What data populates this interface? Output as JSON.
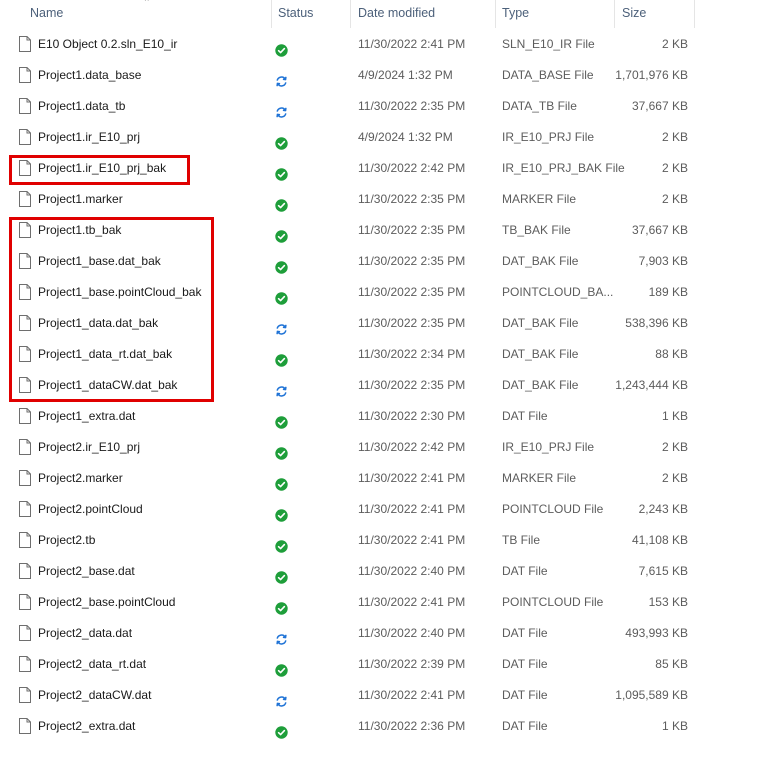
{
  "columns": {
    "name": "Name",
    "status": "Status",
    "date": "Date modified",
    "type": "Type",
    "size": "Size"
  },
  "sort": {
    "column": "name",
    "icon": "chevron-up-icon"
  },
  "colors": {
    "synced": "#1e9e3a",
    "syncing": "#1f73d6",
    "highlight": "#e00000"
  },
  "files": [
    {
      "name": "E10 Object 0.2.sln_E10_ir",
      "status": "synced",
      "date": "11/30/2022 2:41 PM",
      "type": "SLN_E10_IR File",
      "size": "2 KB"
    },
    {
      "name": "Project1.data_base",
      "status": "syncing",
      "date": "4/9/2024 1:32 PM",
      "type": "DATA_BASE File",
      "size": "1,701,976 KB"
    },
    {
      "name": "Project1.data_tb",
      "status": "syncing",
      "date": "11/30/2022 2:35 PM",
      "type": "DATA_TB File",
      "size": "37,667 KB"
    },
    {
      "name": "Project1.ir_E10_prj",
      "status": "synced",
      "date": "4/9/2024 1:32 PM",
      "type": "IR_E10_PRJ File",
      "size": "2 KB"
    },
    {
      "name": "Project1.ir_E10_prj_bak",
      "status": "synced",
      "date": "11/30/2022 2:42 PM",
      "type": "IR_E10_PRJ_BAK File",
      "size": "2 KB"
    },
    {
      "name": "Project1.marker",
      "status": "synced",
      "date": "11/30/2022 2:35 PM",
      "type": "MARKER File",
      "size": "2 KB"
    },
    {
      "name": "Project1.tb_bak",
      "status": "synced",
      "date": "11/30/2022 2:35 PM",
      "type": "TB_BAK File",
      "size": "37,667 KB"
    },
    {
      "name": "Project1_base.dat_bak",
      "status": "synced",
      "date": "11/30/2022 2:35 PM",
      "type": "DAT_BAK File",
      "size": "7,903 KB"
    },
    {
      "name": "Project1_base.pointCloud_bak",
      "status": "synced",
      "date": "11/30/2022 2:35 PM",
      "type": "POINTCLOUD_BA...",
      "size": "189 KB"
    },
    {
      "name": "Project1_data.dat_bak",
      "status": "syncing",
      "date": "11/30/2022 2:35 PM",
      "type": "DAT_BAK File",
      "size": "538,396 KB"
    },
    {
      "name": "Project1_data_rt.dat_bak",
      "status": "synced",
      "date": "11/30/2022 2:34 PM",
      "type": "DAT_BAK File",
      "size": "88 KB"
    },
    {
      "name": "Project1_dataCW.dat_bak",
      "status": "syncing",
      "date": "11/30/2022 2:35 PM",
      "type": "DAT_BAK File",
      "size": "1,243,444 KB"
    },
    {
      "name": "Project1_extra.dat",
      "status": "synced",
      "date": "11/30/2022 2:30 PM",
      "type": "DAT File",
      "size": "1 KB"
    },
    {
      "name": "Project2.ir_E10_prj",
      "status": "synced",
      "date": "11/30/2022 2:42 PM",
      "type": "IR_E10_PRJ File",
      "size": "2 KB"
    },
    {
      "name": "Project2.marker",
      "status": "synced",
      "date": "11/30/2022 2:41 PM",
      "type": "MARKER File",
      "size": "2 KB"
    },
    {
      "name": "Project2.pointCloud",
      "status": "synced",
      "date": "11/30/2022 2:41 PM",
      "type": "POINTCLOUD File",
      "size": "2,243 KB"
    },
    {
      "name": "Project2.tb",
      "status": "synced",
      "date": "11/30/2022 2:41 PM",
      "type": "TB File",
      "size": "41,108 KB"
    },
    {
      "name": "Project2_base.dat",
      "status": "synced",
      "date": "11/30/2022 2:40 PM",
      "type": "DAT File",
      "size": "7,615 KB"
    },
    {
      "name": "Project2_base.pointCloud",
      "status": "synced",
      "date": "11/30/2022 2:41 PM",
      "type": "POINTCLOUD File",
      "size": "153 KB"
    },
    {
      "name": "Project2_data.dat",
      "status": "syncing",
      "date": "11/30/2022 2:40 PM",
      "type": "DAT File",
      "size": "493,993 KB"
    },
    {
      "name": "Project2_data_rt.dat",
      "status": "synced",
      "date": "11/30/2022 2:39 PM",
      "type": "DAT File",
      "size": "85 KB"
    },
    {
      "name": "Project2_dataCW.dat",
      "status": "syncing",
      "date": "11/30/2022 2:41 PM",
      "type": "DAT File",
      "size": "1,095,589 KB"
    },
    {
      "name": "Project2_extra.dat",
      "status": "synced",
      "date": "11/30/2022 2:36 PM",
      "type": "DAT File",
      "size": "1 KB"
    }
  ],
  "highlights": [
    {
      "label": "highlight-single",
      "rows": [
        4
      ]
    },
    {
      "label": "highlight-group",
      "rows": [
        6,
        7,
        8,
        9,
        10,
        11
      ]
    }
  ]
}
